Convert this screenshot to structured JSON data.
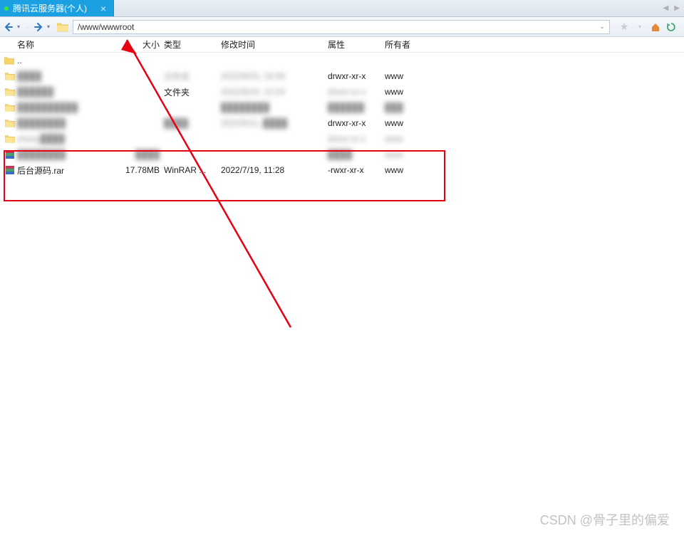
{
  "titlebar": {
    "tab_label": "腾讯云服务器(个人)",
    "tab_close": "×"
  },
  "toolbar": {
    "path": "/www/wwwroot"
  },
  "columns": {
    "name": "名称",
    "size": "大小",
    "type": "类型",
    "modified": "修改时间",
    "attr": "属性",
    "owner": "所有者"
  },
  "parent": {
    "dots": ".."
  },
  "rows": [
    {
      "icon": "folder",
      "name": "████",
      "size": "",
      "type": "文件夹",
      "modified": "2022/8/20, 16:48",
      "attr": "drwxr-xr-x",
      "owner": "www",
      "blur_name": true,
      "blur_type": true,
      "blur_modified": true
    },
    {
      "icon": "folder",
      "name": "██████",
      "size": "",
      "type": "文件夹",
      "modified": "2022/8/24, 12:24",
      "attr": "drwxr-xr-x",
      "owner": "www",
      "blur_name": true,
      "blur_modified": true,
      "blur_attr": true
    },
    {
      "icon": "folder",
      "name": "██████████",
      "size": "",
      "type": "",
      "modified": "████████",
      "attr": "██████",
      "owner": "███",
      "blur_name": true,
      "blur_modified": true,
      "blur_attr": true,
      "blur_owner": true
    },
    {
      "icon": "folder",
      "name": "████████",
      "size": "",
      "type": "████",
      "modified": "2022/5/11, ████",
      "attr": "drwxr-xr-x",
      "owner": "www",
      "blur_name": true,
      "blur_type": true,
      "blur_modified": true
    },
    {
      "icon": "folder",
      "name": "zhang████",
      "size": "",
      "type": "",
      "modified": "",
      "attr": "drwxr-xr-x",
      "owner": "www",
      "blur_name": true,
      "blur_attr": true,
      "blur_owner": true
    },
    {
      "icon": "rar",
      "name": "████████",
      "size": "████",
      "type": "",
      "modified": "",
      "attr": "████",
      "owner": "www",
      "blur_all": true
    },
    {
      "icon": "rar",
      "name": "后台源码.rar",
      "size": "17.78MB",
      "type": "WinRAR ...",
      "modified": "2022/7/19, 11:28",
      "attr": "-rwxr-xr-x",
      "owner": "www"
    }
  ],
  "watermark": "CSDN @骨子里的偏爱"
}
